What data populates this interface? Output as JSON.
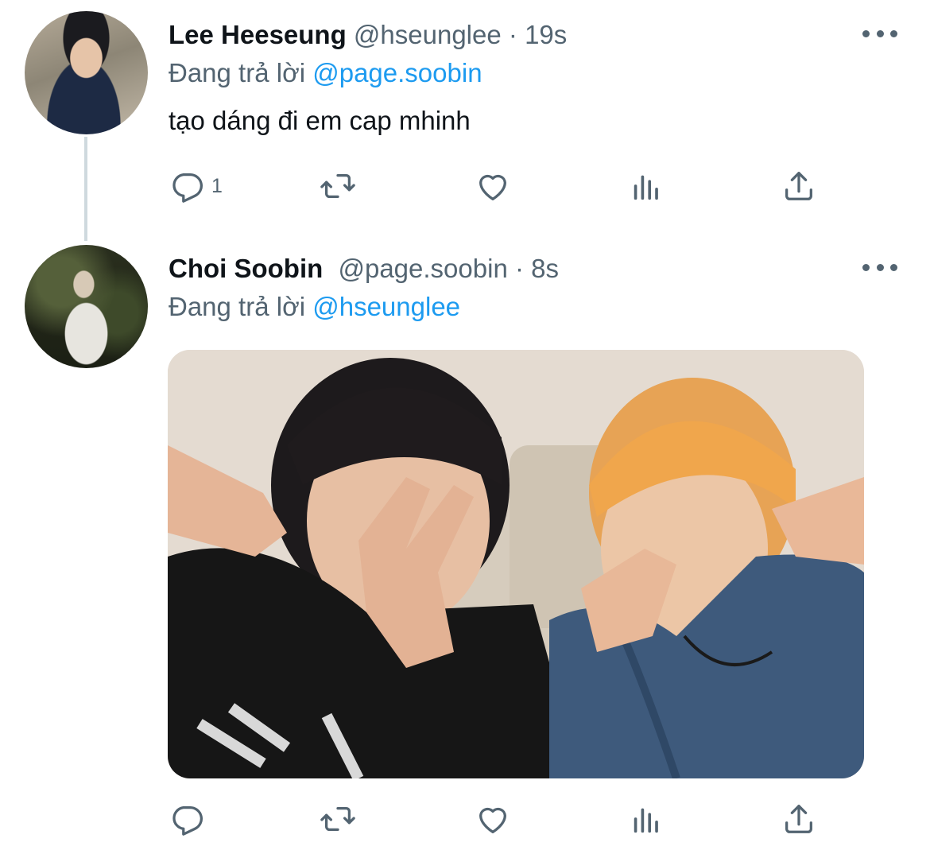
{
  "thread": [
    {
      "display_name": "Lee Heeseung",
      "handle": "@hseunglee",
      "separator": "·",
      "time": "19s",
      "reply_prefix": "Đang trả lời",
      "reply_to": "@page.soobin",
      "text": "tạo dáng đi em cap mhinh",
      "reply_count": "1",
      "has_media": false
    },
    {
      "display_name": "Choi Soobin",
      "handle": "@page.soobin",
      "separator": "·",
      "time": "8s",
      "reply_prefix": "Đang trả lời",
      "reply_to": "@hseunglee",
      "text": "",
      "reply_count": "",
      "has_media": true
    }
  ],
  "icons": {
    "reply": "reply-icon",
    "retweet": "retweet-icon",
    "like": "heart-icon",
    "views": "analytics-icon",
    "share": "share-icon",
    "more": "more-icon"
  },
  "colors": {
    "link": "#1d9bf0",
    "secondary_text": "#536471",
    "primary_text": "#0f1419",
    "thread_line": "#cfd9de"
  }
}
